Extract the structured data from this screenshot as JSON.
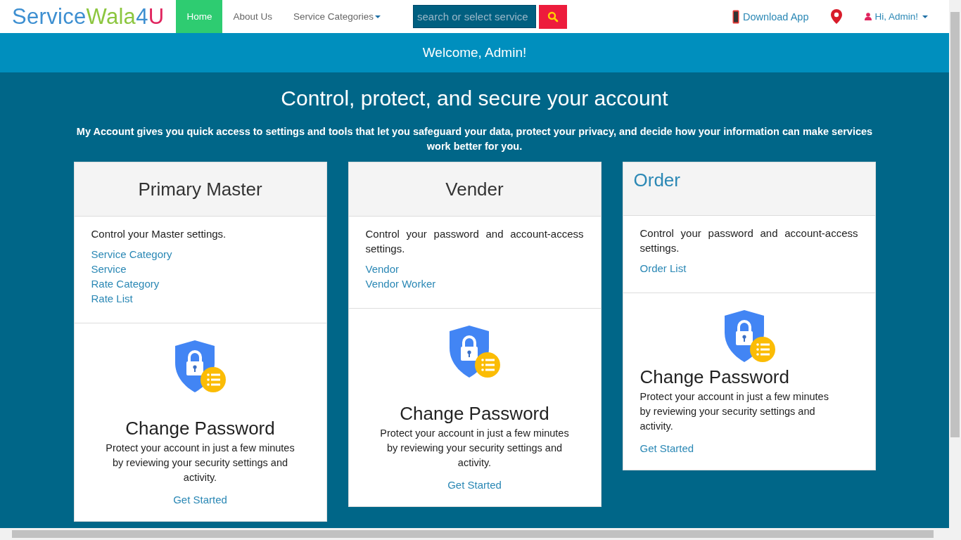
{
  "navbar": {
    "brand": [
      {
        "text": "Service",
        "color": "#3d8fd1"
      },
      {
        "text": "Wala",
        "color": "#8cc63f"
      },
      {
        "text": "4",
        "color": "#3d8fd1"
      },
      {
        "text": "U",
        "color": "#e0245e"
      }
    ],
    "links": [
      {
        "label": "Home",
        "selected": true,
        "dropdown": false
      },
      {
        "label": "About Us",
        "selected": false,
        "dropdown": false
      },
      {
        "label": "Service Categories",
        "selected": false,
        "dropdown": true
      }
    ],
    "search": {
      "placeholder": "search or select service"
    },
    "download": "Download App",
    "user": "Hi, Admin!"
  },
  "welcome": "Welcome, Admin!",
  "heading": "Control, protect, and secure your account",
  "intro": "My Account gives you quick access to settings and tools that let you safeguard your data, protect your privacy, and decide how your information can make services work better for you.",
  "cards": [
    {
      "kind": "centered",
      "title": "Primary Master",
      "description": "Control your Master settings.",
      "links": [
        "Service Category",
        "Service",
        "Rate Category",
        "Rate List"
      ],
      "action_title": "Change Password",
      "action_text": "Protect your account in just a few minutes by reviewing your security settings and activity.",
      "action_link": "Get Started"
    },
    {
      "kind": "centered",
      "title": "Vender",
      "description": "Control your password and account-access settings.",
      "links": [
        "Vendor",
        "Vendor Worker"
      ],
      "action_title": "Change Password",
      "action_text": "Protect your account in just a few minutes by reviewing your security settings and activity.",
      "action_link": "Get Started"
    },
    {
      "kind": "left",
      "title": "Order",
      "description": "Control your password and account-access settings.",
      "links": [
        "Order List"
      ],
      "action_title": "Change Password",
      "action_text": "Protect your account in just a few minutes by reviewing your security settings and activity.",
      "action_link": "Get Started"
    }
  ]
}
